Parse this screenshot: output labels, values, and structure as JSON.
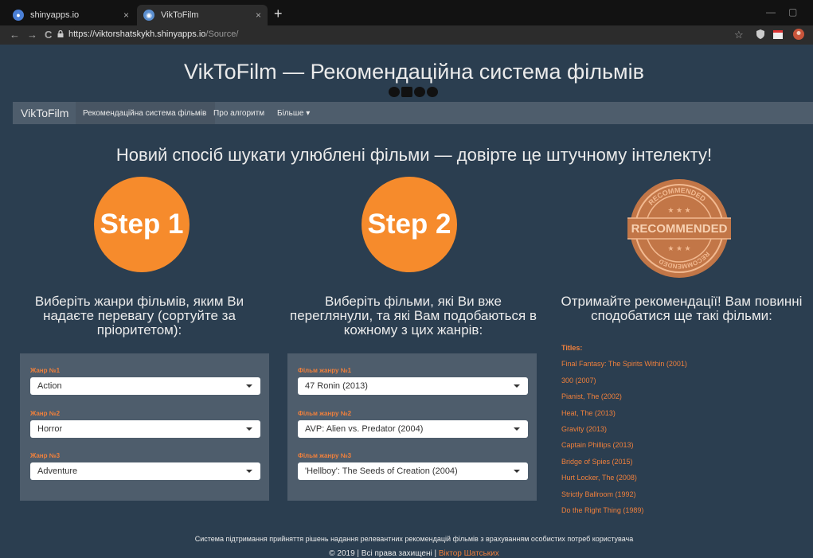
{
  "browser": {
    "tabs": [
      {
        "title": "shinyapps.io",
        "active": false
      },
      {
        "title": "VikToFilm",
        "active": true
      }
    ],
    "url_host": "https://viktorshatskykh.shinyapps.io",
    "url_path": "/Source/",
    "new_tab": "+",
    "back": "←",
    "forward": "→",
    "reload": "C",
    "close": "×",
    "star": "☆"
  },
  "site": {
    "title": "VikToFilm — Рекомендаційна система фільмів",
    "social_icons": [
      "facebook-icon",
      "linkedin-icon",
      "twitter-icon",
      "github-icon"
    ]
  },
  "navbar": {
    "brand": "VikToFilm",
    "links": [
      "Рекомендаційна система фільмів",
      "Про алгоритм",
      "Більше"
    ]
  },
  "headline": "Новий спосіб шукати улюблені фільми — довірте це штучному інтелекту!",
  "steps": [
    "Step 1",
    "Step 2"
  ],
  "seal": {
    "text": "RECOMMENDED",
    "ring_top": "RECOMMENDED",
    "ring_bottom": "RECOMMENDED"
  },
  "columns": {
    "col1": [
      "Виберіть жанри фільмів, яким Ви",
      "надаєте перевагу (сортуйте за",
      "пріоритетом):"
    ],
    "col2": [
      "Виберіть фільми, які Ви вже",
      "переглянули, та які Вам подобаються в",
      "кожному з цих жанрів:"
    ],
    "col3": [
      "Отримайте рекомендації! Вам повинні",
      "сподобатися ще такі фільми:"
    ]
  },
  "genres": [
    {
      "label": "Жанр №1",
      "value": "Action"
    },
    {
      "label": "Жанр №2",
      "value": "Horror"
    },
    {
      "label": "Жанр №3",
      "value": "Adventure"
    }
  ],
  "films": [
    {
      "label": "Фільм жанру №1",
      "value": "47 Ronin (2013)"
    },
    {
      "label": "Фільм жанру №2",
      "value": "AVP: Alien vs. Predator (2004)"
    },
    {
      "label": "Фільм жанру №3",
      "value": "'Hellboy': The Seeds of Creation (2004)"
    }
  ],
  "recommendations": {
    "header": "Titles:",
    "titles": [
      "Final Fantasy: The Spirits Within (2001)",
      "300 (2007)",
      "Pianist, The (2002)",
      "Heat, The (2013)",
      "Gravity (2013)",
      "Captain Phillips (2013)",
      "Bridge of Spies (2015)",
      "Hurt Locker, The (2008)",
      "Strictly Ballroom (1992)",
      "Do the Right Thing (1989)"
    ]
  },
  "footer": {
    "line1": "Система підтримання прийняття рішень надання релевантних рекомендацій фільмів з врахуванням особистих потреб користувача",
    "copyright": "© 2019 | Всі права захищені |",
    "author": "Віктор Шатських"
  },
  "colors": {
    "accent": "#f68b2c",
    "link": "#f0803c",
    "bg": "#2b3e50",
    "panel": "#4e5d6c"
  }
}
